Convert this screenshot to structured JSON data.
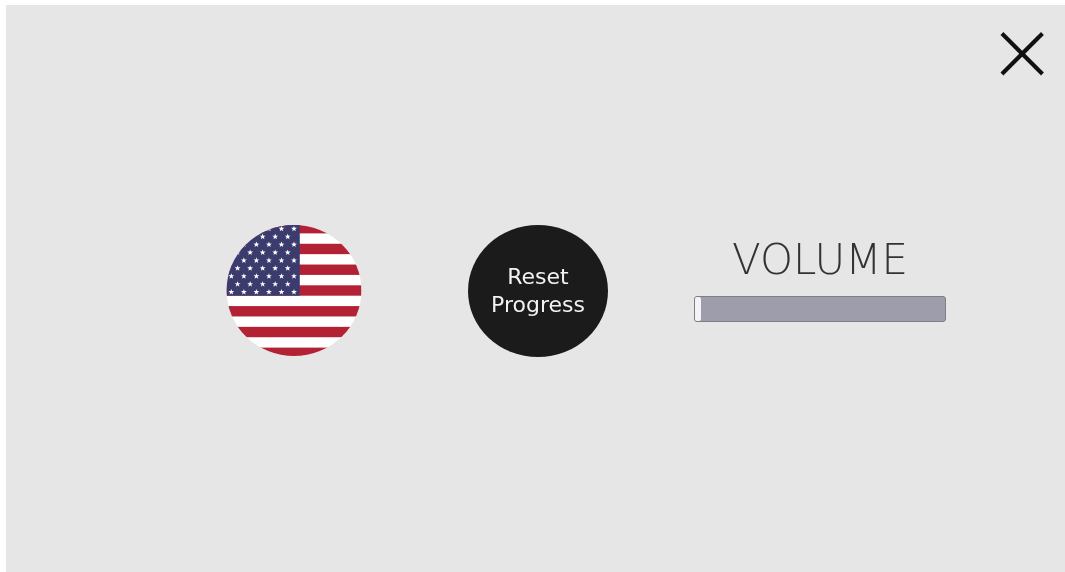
{
  "close_button": {
    "label": "×"
  },
  "language": {
    "kind": "flag"
  },
  "reset_button": {
    "label": "Reset Progress"
  },
  "volume": {
    "label": "VOLUME",
    "level": 0.0
  }
}
